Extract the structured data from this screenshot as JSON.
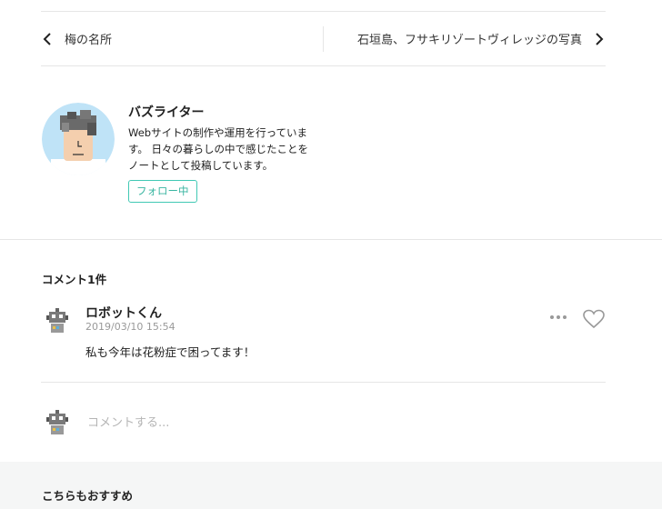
{
  "nav": {
    "prev_label": "梅の名所",
    "next_label": "石垣島、フサキリゾートヴィレッジの写真"
  },
  "author": {
    "name": "バズライター",
    "bio": "Webサイトの制作や運用を行っています。 日々の暮らしの中で感じたことをノートとして投稿しています。",
    "follow_label": "フォロー中"
  },
  "comments": {
    "heading": "コメント1件",
    "items": [
      {
        "name": "ロボットくん",
        "time": "2019/03/10 15:54",
        "text": "私も今年は花粉症で困ってます！"
      }
    ],
    "input_placeholder": "コメントする..."
  },
  "recommend": {
    "heading": "こちらもおすすめ"
  },
  "colors": {
    "follow_accent": "#41c9b4",
    "avatar_bg": "#bfe3f7",
    "divider": "#e6e6e6",
    "footer_bg": "#f5f6f6"
  },
  "icons": [
    "chevron-left-icon",
    "chevron-right-icon",
    "robot-avatar-icon",
    "more-icon",
    "heart-icon"
  ]
}
